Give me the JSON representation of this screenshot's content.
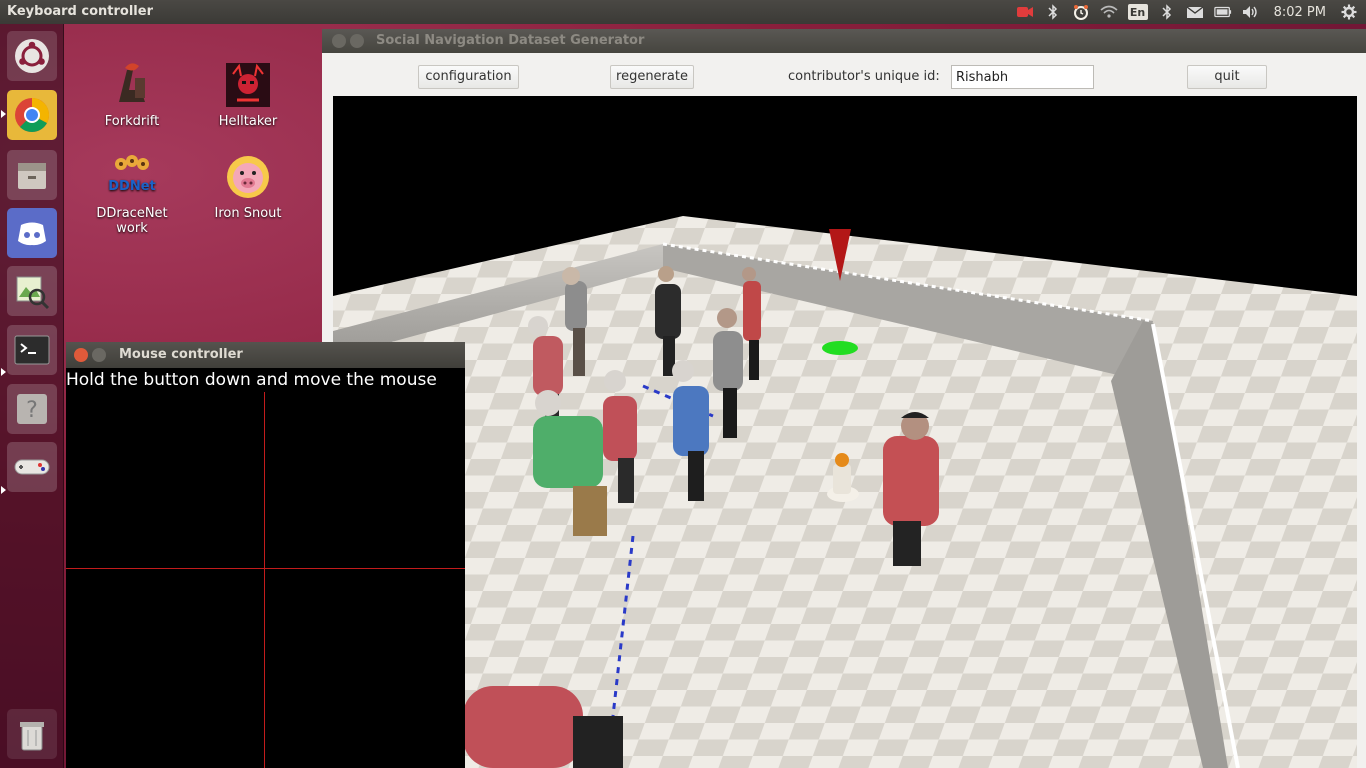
{
  "topbar": {
    "title": "Keyboard controller",
    "clock": "8:02 PM",
    "keyboard_layout": "En",
    "icons": [
      "camera-icon",
      "bluetooth-icon",
      "alarm-icon",
      "wifi-icon",
      "keyboard-icon",
      "bluetooth-icon",
      "mail-icon",
      "battery-icon",
      "volume-icon",
      "gear-icon"
    ]
  },
  "launcher": {
    "items": [
      "ubuntu-dash-icon",
      "chrome-icon",
      "files-icon",
      "discord-icon",
      "image-viewer-icon",
      "terminal-icon",
      "help-icon",
      "gamepad-icon",
      "trash-icon"
    ]
  },
  "desktop": {
    "icons": [
      {
        "label": "Forkdrift"
      },
      {
        "label": "Helltaker"
      },
      {
        "label": "DDraceNet work"
      },
      {
        "label": "Iron Snout"
      }
    ],
    "ddnet_logo_text": "DDNet"
  },
  "main_window": {
    "title": "Social Navigation Dataset Generator",
    "toolbar": {
      "configuration_label": "configuration",
      "regenerate_label": "regenerate",
      "uid_label": "contributor's unique id:",
      "uid_value": "Rishabh",
      "quit_label": "quit"
    }
  },
  "mouse_window": {
    "title": "Mouse controller",
    "instruction": "Hold the button down and move the mouse"
  }
}
